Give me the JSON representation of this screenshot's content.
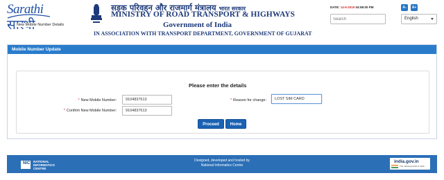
{
  "header": {
    "logo_latin": "Sarathi",
    "logo_hindi": "सारथी",
    "ministry_hindi": "सड़क परिवहन और राजमार्ग मंत्रालय",
    "bharat_sarkar": "भारत सरकार",
    "ministry_english": "MINISTRY OF ROAD TRANSPORT & HIGHWAYS",
    "government": "Government of India",
    "association": "IN ASSOCIATION WITH TRANSPORT DEPARTMENT, GOVERNMENT OF GUJARAT",
    "date_label": "DATE:",
    "date_value": "14-5-2019",
    "time_value": "04:58:00 PM",
    "font_minus": "A-",
    "font_plus": "A+",
    "search_placeholder": "Search",
    "language_selected": "English"
  },
  "panel": {
    "title": "Mobile Number Update",
    "legend": "New Mobile Number Details",
    "heading": "Please enter the details",
    "new_mobile_label": "New Mobile Number:",
    "new_mobile_value": "9104837613",
    "confirm_mobile_label": "Confirm New Mobile Number:",
    "confirm_mobile_value": "9104837613",
    "reason_label": "Reason for change:",
    "reason_value": "LOST SIM CARD",
    "required_mark": "*",
    "proceed_label": "Proceed",
    "home_label": "Home"
  },
  "footer": {
    "nic_logo_text": "NIC",
    "nic_name": "NATIONAL INFORMATICS CENTRE",
    "line1": "Designed, developed and hosted by",
    "line2": "National Informatics Centre",
    "india_gov_title": "india.gov.in",
    "india_gov_sub": "The national portal of India"
  },
  "colors": {
    "accent": "#2a7ccb",
    "brand_blue": "#1e3a7a",
    "button": "#1a62b3",
    "required": "#d0282d",
    "footer": "#2b6fb7"
  }
}
